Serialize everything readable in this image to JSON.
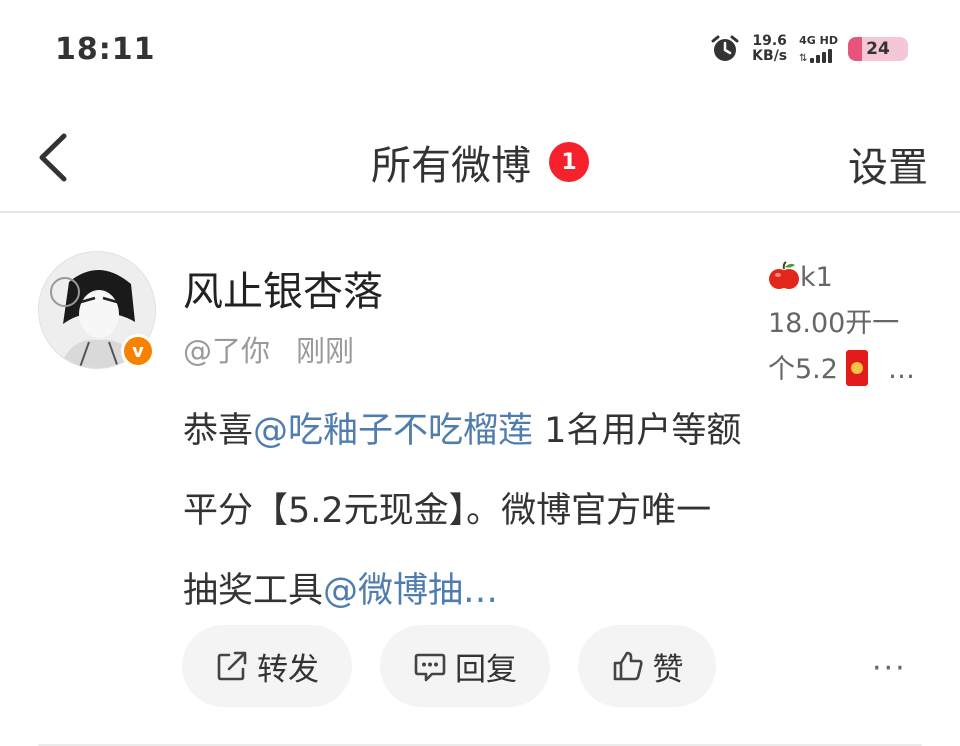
{
  "status_bar": {
    "time": "18:11",
    "net_speed_value": "19.6",
    "net_speed_unit": "KB/s",
    "network_label": "4G HD",
    "battery": "24",
    "battery_level": 0.24
  },
  "nav": {
    "title": "所有微博",
    "badge_count": "1",
    "settings_label": "设置"
  },
  "post": {
    "username": "风止银杏落",
    "handle": "@了你",
    "time": "刚刚",
    "verified_badge": "v",
    "side_line1": "k1",
    "side_line2": "18.00开一",
    "side_line3": "个5.2",
    "side_more": "…",
    "content": {
      "part1": "恭喜",
      "mention1": "@吃釉子不吃榴莲",
      "part2": " 1名用户等额平分【5.2元现金】。微博官方唯一抽奖工具",
      "mention2": "@微博抽…"
    },
    "actions": {
      "repost": "转发",
      "comment": "回复",
      "like": "赞"
    },
    "more": "···"
  },
  "colors": {
    "accent_red": "#f5222d",
    "mention_blue": "#507daf",
    "verified_orange": "#f78200",
    "battery_pink": "#e7557d"
  }
}
